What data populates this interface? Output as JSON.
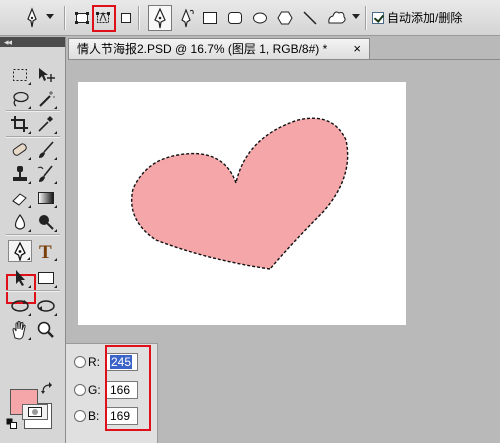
{
  "options_bar": {
    "auto_add_label": "自动添加/删除",
    "auto_add_checked": true,
    "selected_path_mode": "paths"
  },
  "document": {
    "tab_title": "情人节海报2.PSD @ 16.7% (图层 1, RGB/8#) *",
    "close_glyph": "×"
  },
  "toolbox": {
    "collapse_glyph": "◂◂",
    "active_tool": "pen-tool"
  },
  "color_picker": {
    "r_label": "R:",
    "g_label": "G:",
    "b_label": "B:",
    "r_value": "245",
    "g_value": "166",
    "b_value": "169",
    "foreground_color": "#f5a6a9",
    "background_color": "#ffffff"
  },
  "shape": {
    "fill_color": "#f5a6a9",
    "description": "heart"
  },
  "colors": {
    "highlight": "#e0101a",
    "selection_blue": "#3b64c8",
    "canvas_bg": "#ffffff",
    "workspace_bg": "#b9b9b9"
  }
}
